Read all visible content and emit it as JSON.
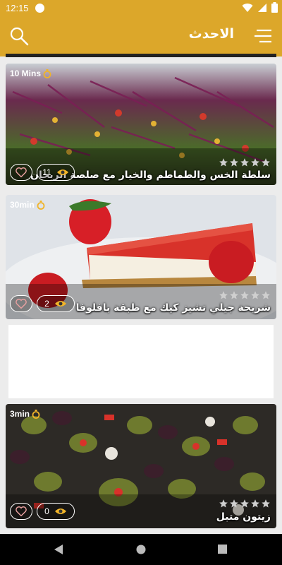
{
  "status_bar": {
    "time": "12:15"
  },
  "app_bar": {
    "title": "الاحدث"
  },
  "recipes": [
    {
      "time": "10 Mins",
      "title": "سلطة الخس والطماطم والخيار مع صلصة الريحان",
      "views": "11",
      "rating": 0
    },
    {
      "time": "30min",
      "title": "شريحة جيلي تشيز كيك مع طبقة بافلوفا",
      "views": "2",
      "rating": 0
    },
    {
      "time": "3min",
      "title": "زيتون متبل",
      "views": "0",
      "rating": 0
    }
  ],
  "colors": {
    "primary": "#dca72a",
    "timer_icon": "#f0b429"
  },
  "icons": {
    "search": "search-icon",
    "menu": "menu-icon",
    "timer": "timer-icon",
    "heart": "heart-icon",
    "eye": "eye-icon",
    "star": "star-icon",
    "back": "back-icon",
    "home": "home-icon",
    "recents": "recents-icon"
  }
}
